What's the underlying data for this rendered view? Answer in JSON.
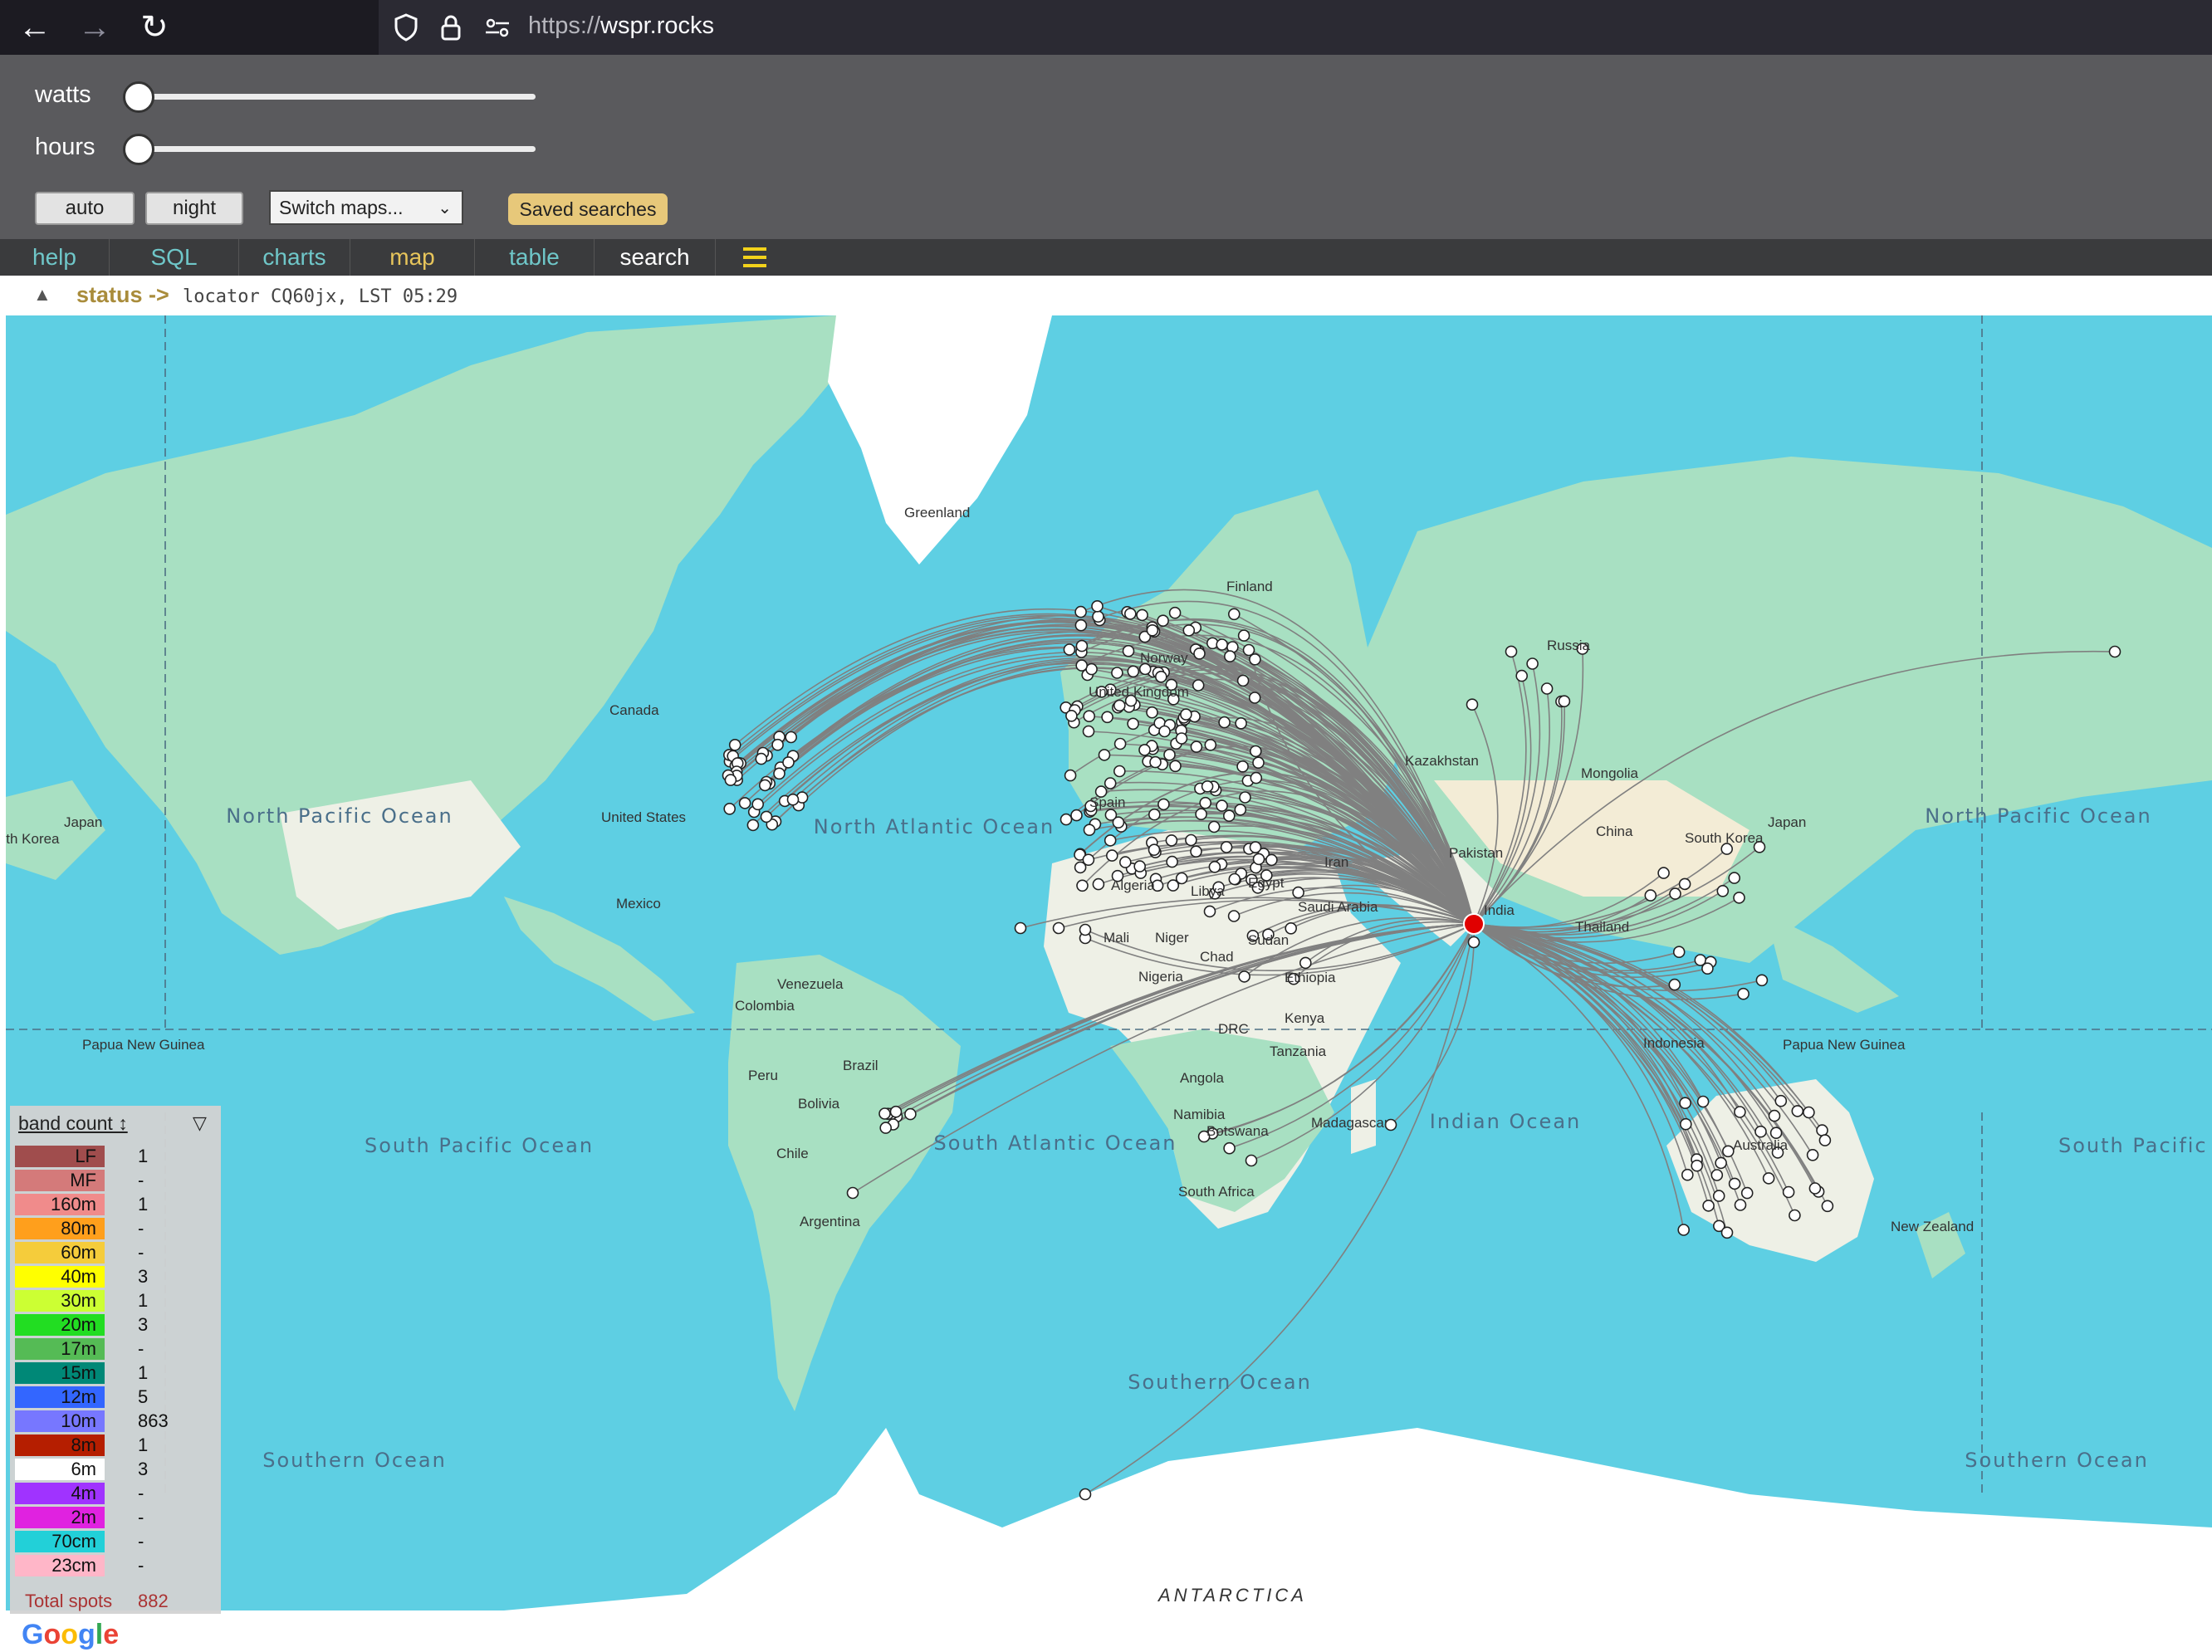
{
  "browser": {
    "url_protocol": "https://",
    "url_domain": "wspr.rocks"
  },
  "controls": {
    "watts_label": "watts",
    "hours_label": "hours",
    "auto_label": "auto",
    "night_label": "night",
    "switch_maps": "Switch maps...",
    "saved_searches": "Saved searches"
  },
  "nav": {
    "tabs": [
      {
        "label": "help",
        "color": "#6fc7c9"
      },
      {
        "label": "SQL",
        "color": "#6fc7c9"
      },
      {
        "label": "charts",
        "color": "#6fc7c9"
      },
      {
        "label": "map",
        "color": "#e7c55b"
      },
      {
        "label": "table",
        "color": "#6fc7c9"
      },
      {
        "label": "search",
        "color": "#ffffff"
      }
    ],
    "menu_icon": "hamburger-icon"
  },
  "status": {
    "label": "status ->",
    "text": "locator CQ60jx, LST 05:29"
  },
  "map": {
    "countries": [
      "Greenland",
      "Finland",
      "Canada",
      "United States",
      "Mexico",
      "Russia",
      "Kazakhstan",
      "Mongolia",
      "China",
      "South Korea",
      "Japan",
      "Japan",
      "South Korea",
      "India",
      "Thailand",
      "Indonesia",
      "Papua New Guinea",
      "Papua New Guinea",
      "Australia",
      "New Zealand",
      "Venezuela",
      "Colombia",
      "Brazil",
      "Peru",
      "Bolivia",
      "Chile",
      "Argentina",
      "Algeria",
      "Libya",
      "Egypt",
      "Saudi Arabia",
      "Mali",
      "Niger",
      "Sudan",
      "Chad",
      "Nigeria",
      "Ethiopia",
      "Kenya",
      "DRC",
      "Tanzania",
      "Angola",
      "Namibia",
      "Botswana",
      "Madagascar",
      "South Africa",
      "Spain",
      "Norway",
      "United Kingdom",
      "Pakistan",
      "Iran",
      "ANTARCTICA"
    ],
    "oceans": [
      {
        "name": "North Pacific Ocean"
      },
      {
        "name": "North Atlantic Ocean"
      },
      {
        "name": "South Pacific Ocean"
      },
      {
        "name": "South Atlantic Ocean"
      },
      {
        "name": "Indian Ocean"
      },
      {
        "name": "Southern Ocean"
      },
      {
        "name": "North Pacific Ocean"
      },
      {
        "name": "South Pacific Ocean"
      },
      {
        "name": "Southern Ocean"
      },
      {
        "name": "Southern Ocean"
      }
    ],
    "colors": {
      "ocean": "#5ecfe3",
      "land": "#a8e0c2",
      "land_light": "#f4f4f0",
      "ice": "#ffffff",
      "path": "#808080",
      "home": "#e00000"
    }
  },
  "legend": {
    "header": "band count ↕",
    "sort_icon": "filter-triangle-icon",
    "bands": [
      {
        "band": "LF",
        "count": "1",
        "color": "#a04d4d"
      },
      {
        "band": "MF",
        "count": "-",
        "color": "#d47a7a"
      },
      {
        "band": "160m",
        "count": "1",
        "color": "#f08b8b"
      },
      {
        "band": "80m",
        "count": "-",
        "color": "#ff9f1c"
      },
      {
        "band": "60m",
        "count": "-",
        "color": "#f5cc3b"
      },
      {
        "band": "40m",
        "count": "3",
        "color": "#ffff00"
      },
      {
        "band": "30m",
        "count": "1",
        "color": "#ccff33"
      },
      {
        "band": "20m",
        "count": "3",
        "color": "#22dd22"
      },
      {
        "band": "17m",
        "count": "-",
        "color": "#55bb55"
      },
      {
        "band": "15m",
        "count": "1",
        "color": "#008877"
      },
      {
        "band": "12m",
        "count": "5",
        "color": "#3366ff"
      },
      {
        "band": "10m",
        "count": "863",
        "color": "#7777ff"
      },
      {
        "band": "8m",
        "count": "1",
        "color": "#b51e00"
      },
      {
        "band": "6m",
        "count": "3",
        "color": "#ffffff"
      },
      {
        "band": "4m",
        "count": "-",
        "color": "#a033ff"
      },
      {
        "band": "2m",
        "count": "-",
        "color": "#e022e0"
      },
      {
        "band": "70cm",
        "count": "-",
        "color": "#22d0d8"
      },
      {
        "band": "23cm",
        "count": "-",
        "color": "#ffb6c8"
      }
    ],
    "total_label": "Total spots",
    "total_value": "882"
  },
  "google_logo": "Google"
}
